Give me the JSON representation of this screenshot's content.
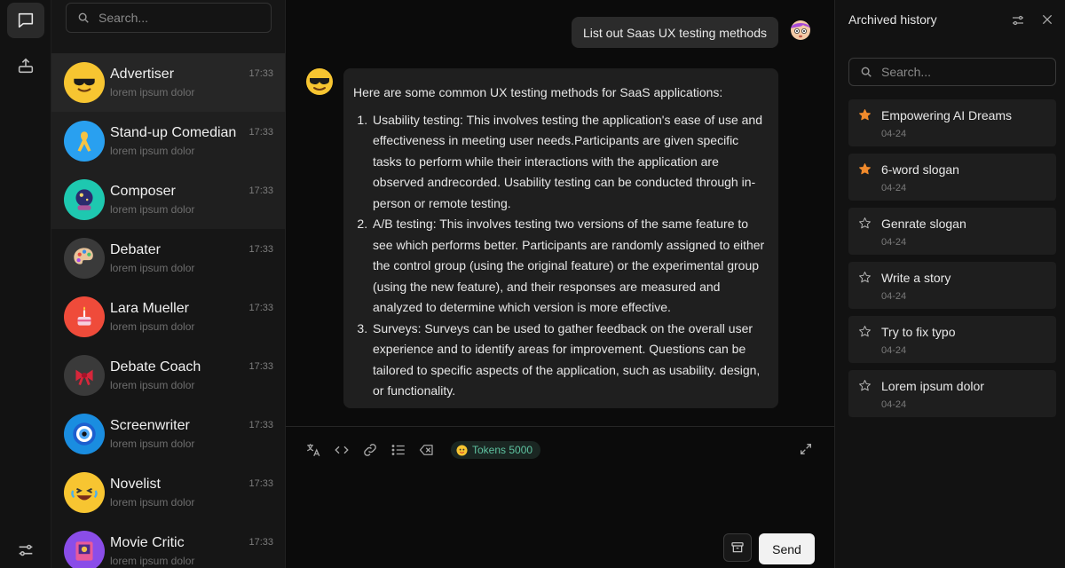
{
  "search": {
    "placeholder": "Search..."
  },
  "chats": [
    {
      "name": "Advertiser",
      "preview": "lorem ipsum dolor",
      "time": "17:33",
      "avatar_icon": "sunglasses-emoji-icon",
      "color": "#f7c531"
    },
    {
      "name": "Stand-up Comedian",
      "preview": "lorem ipsum dolor",
      "time": "17:33",
      "avatar_icon": "ribbon-icon",
      "color": "#29a0f0"
    },
    {
      "name": "Composer",
      "preview": "lorem ipsum dolor",
      "time": "17:33",
      "avatar_icon": "crystal-ball-icon",
      "color": "#1ec8b0"
    },
    {
      "name": "Debater",
      "preview": "lorem ipsum dolor",
      "time": "17:33",
      "avatar_icon": "palette-icon",
      "color": "#3a3a3a"
    },
    {
      "name": "Lara Mueller",
      "preview": "lorem ipsum dolor",
      "time": "17:33",
      "avatar_icon": "cake-icon",
      "color": "#ef4b3a"
    },
    {
      "name": "Debate Coach",
      "preview": "lorem ipsum dolor",
      "time": "17:33",
      "avatar_icon": "bow-icon",
      "color": "#3a3a3a"
    },
    {
      "name": "Screenwriter",
      "preview": "lorem ipsum dolor",
      "time": "17:33",
      "avatar_icon": "eye-amulet-icon",
      "color": "#1a8de0"
    },
    {
      "name": "Novelist",
      "preview": "lorem ipsum dolor",
      "time": "17:33",
      "avatar_icon": "laughing-emoji-icon",
      "color": "#f7c531"
    },
    {
      "name": "Movie Critic",
      "preview": "lorem ipsum dolor",
      "time": "17:33",
      "avatar_icon": "picture-icon",
      "color": "#8a4de8"
    }
  ],
  "conversation": {
    "user_message": "List out Saas UX testing methods",
    "bot_intro": "Here are some common UX testing methods for SaaS applications:",
    "bot_items": [
      "Usability testing: This involves testing the application's ease of use and effectiveness in meeting user needs.Participants are given specific tasks to perform while their interactions with the application are observed andrecorded. Usability testing can be conducted through in-person or remote testing.",
      "A/B testing: This involves testing two versions of the same feature to see which performs better. Participants are randomly assigned to either the control group (using the original feature) or the experimental group (using the new feature), and their responses are measured and analyzed to determine which version is more effective.",
      "Surveys: Surveys can be used to gather feedback on the overall user experience and to identify areas for improvement. Questions can be tailored to specific aspects of the application, such as usability. design, or functionality."
    ]
  },
  "composer": {
    "tokens_label": "Tokens 5000",
    "send_label": "Send"
  },
  "archive": {
    "title": "Archived history",
    "search_placeholder": "Search...",
    "items": [
      {
        "title": "Empowering AI Dreams",
        "date": "04-24",
        "starred": true
      },
      {
        "title": "6-word slogan",
        "date": "04-24",
        "starred": true
      },
      {
        "title": "Genrate slogan",
        "date": "04-24",
        "starred": false
      },
      {
        "title": "Write a story",
        "date": "04-24",
        "starred": false
      },
      {
        "title": "Try to fix typo",
        "date": "04-24",
        "starred": false
      },
      {
        "title": "Lorem ipsum dolor",
        "date": "04-24",
        "starred": false
      }
    ]
  },
  "colors": {
    "star_active": "#f08a2c",
    "token_text": "#5ec2a0"
  }
}
